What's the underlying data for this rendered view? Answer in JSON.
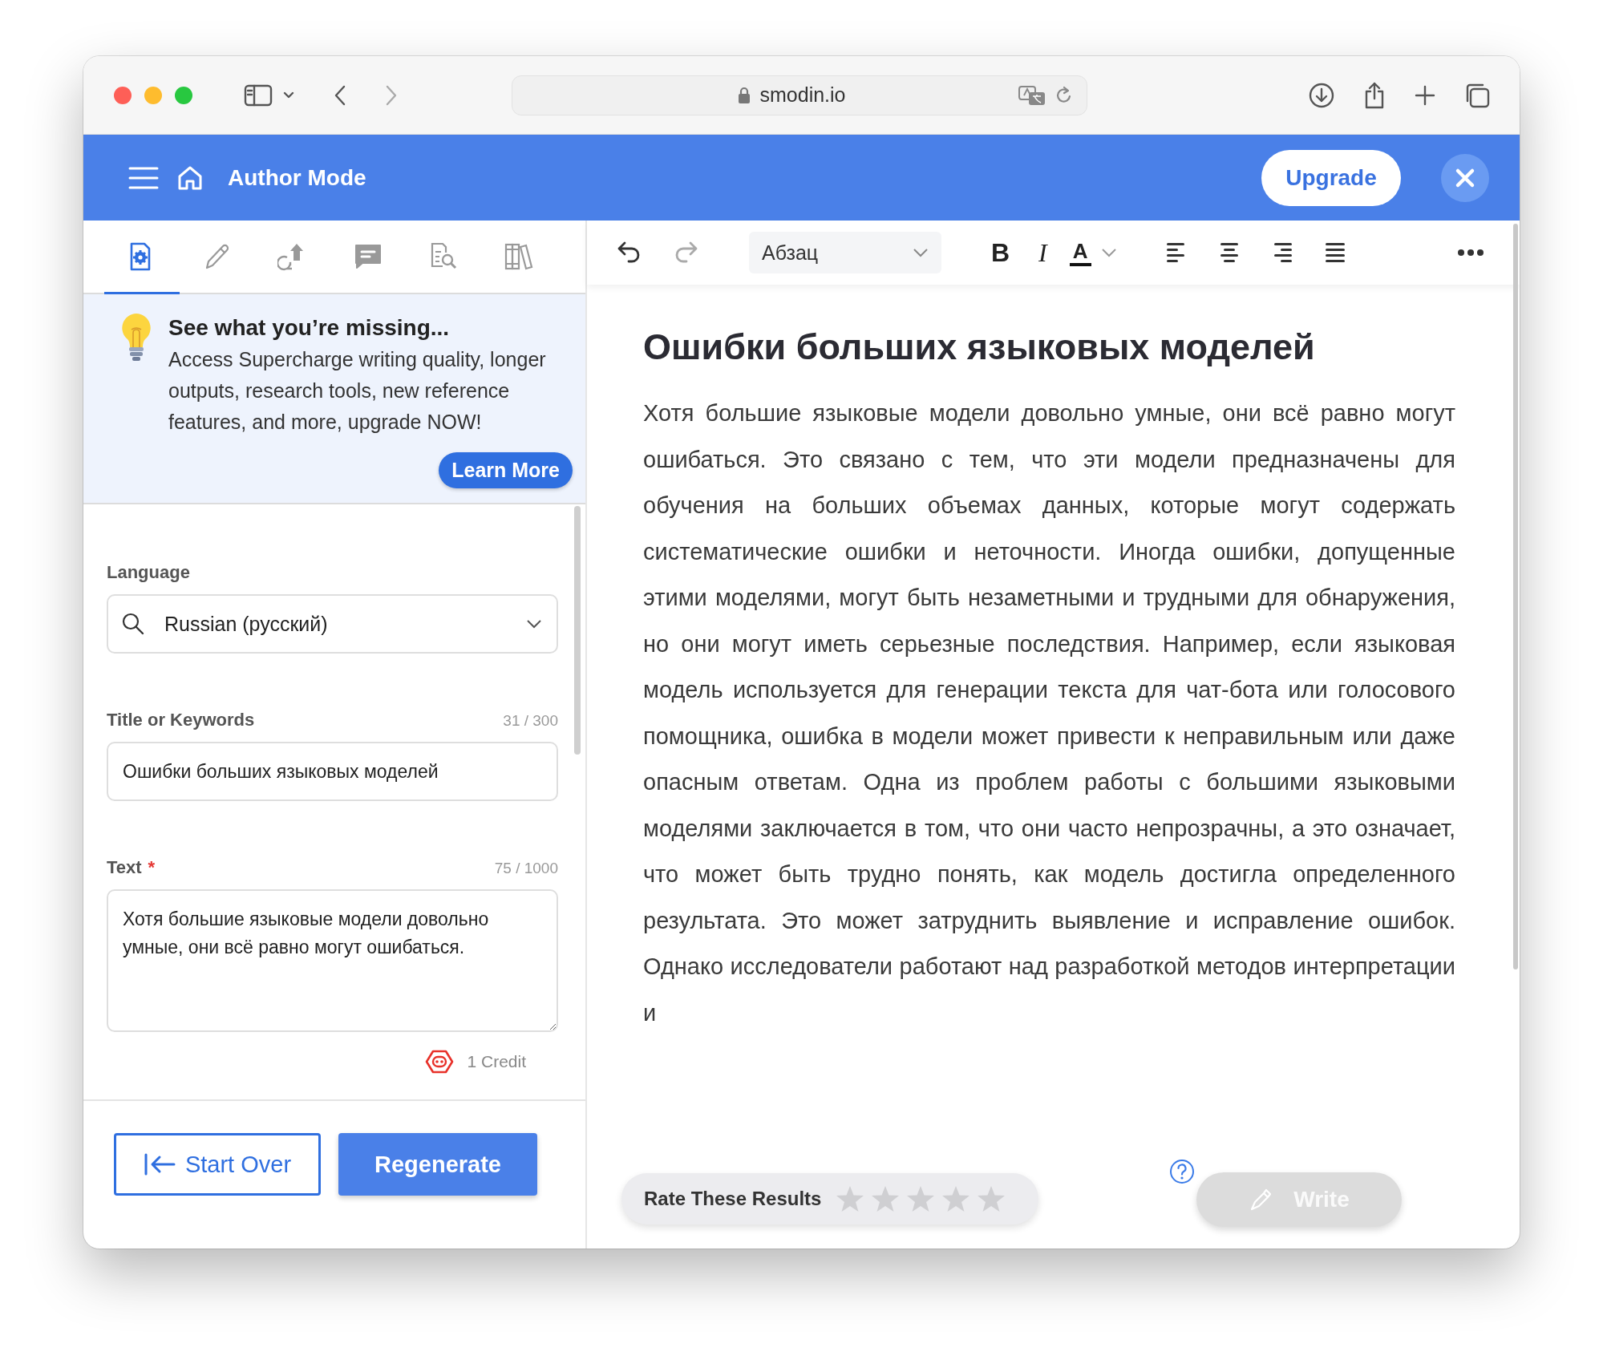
{
  "browser": {
    "url": "smodin.io"
  },
  "header": {
    "title": "Author Mode",
    "upgrade_button": "Upgrade"
  },
  "tabs": [
    {
      "selected": true
    },
    {
      "selected": false
    },
    {
      "selected": false
    },
    {
      "selected": false
    },
    {
      "selected": false
    },
    {
      "selected": false
    }
  ],
  "promo": {
    "title": "See what you’re missing...",
    "text": "Access Supercharge writing quality, longer outputs, research tools, new reference features, and more, upgrade NOW!",
    "button": "Learn More"
  },
  "form": {
    "language": {
      "label": "Language",
      "value": "Russian (русский)"
    },
    "title_field": {
      "label": "Title or Keywords",
      "counter": "31 / 300",
      "value": "Ошибки больших языковых моделей"
    },
    "text_field": {
      "label": "Text",
      "required_mark": "*",
      "counter": "75 / 1000",
      "value": "Хотя большие языковые модели довольно умные, они всё равно могут ошибаться."
    },
    "cost": "1 Credit"
  },
  "footer_buttons": {
    "start_over": "Start Over",
    "regenerate": "Regenerate"
  },
  "editor_toolbar": {
    "history": [
      {
        "kind": "undo",
        "disabled": false
      },
      {
        "kind": "redo",
        "disabled": true
      }
    ],
    "block_format": "Абзац",
    "format_buttons": [
      {
        "kind": "bold",
        "label": "B"
      },
      {
        "kind": "italic",
        "label": "I"
      },
      {
        "kind": "color",
        "label": "A"
      }
    ],
    "align_buttons": [
      {
        "kind": "left"
      },
      {
        "kind": "center"
      },
      {
        "kind": "right"
      },
      {
        "kind": "justify"
      }
    ]
  },
  "document": {
    "heading": "Ошибки больших языковых моделей",
    "paragraph": "Хотя большие языковые модели довольно умные, они всё равно могут ошибаться. Это связано с тем, что эти модели предназначены для обучения на больших объемах данных, которые могут содержать систематические ошибки и неточности. Иногда ошибки, допущенные этими моделями, могут быть незаметными и трудными для обнаружения, но они могут иметь серьезные последствия. Например, если языковая модель используется для генерации текста для чат-бота или голосового помощника, ошибка в модели может привести к неправильным или даже опасным ответам. Одна из проблем работы с большими языковыми моделями заключается в том, что они часто непрозрачны, а это означает, что может быть трудно понять, как модель достигла определенного результата. Это может затруднить выявление и исправление ошибок. Однако исследователи работают над разработкой методов интерпретации и"
  },
  "rating": {
    "label": "Rate These Results",
    "stars": 0
  },
  "write_button": {
    "label": "Write",
    "disabled": true
  }
}
